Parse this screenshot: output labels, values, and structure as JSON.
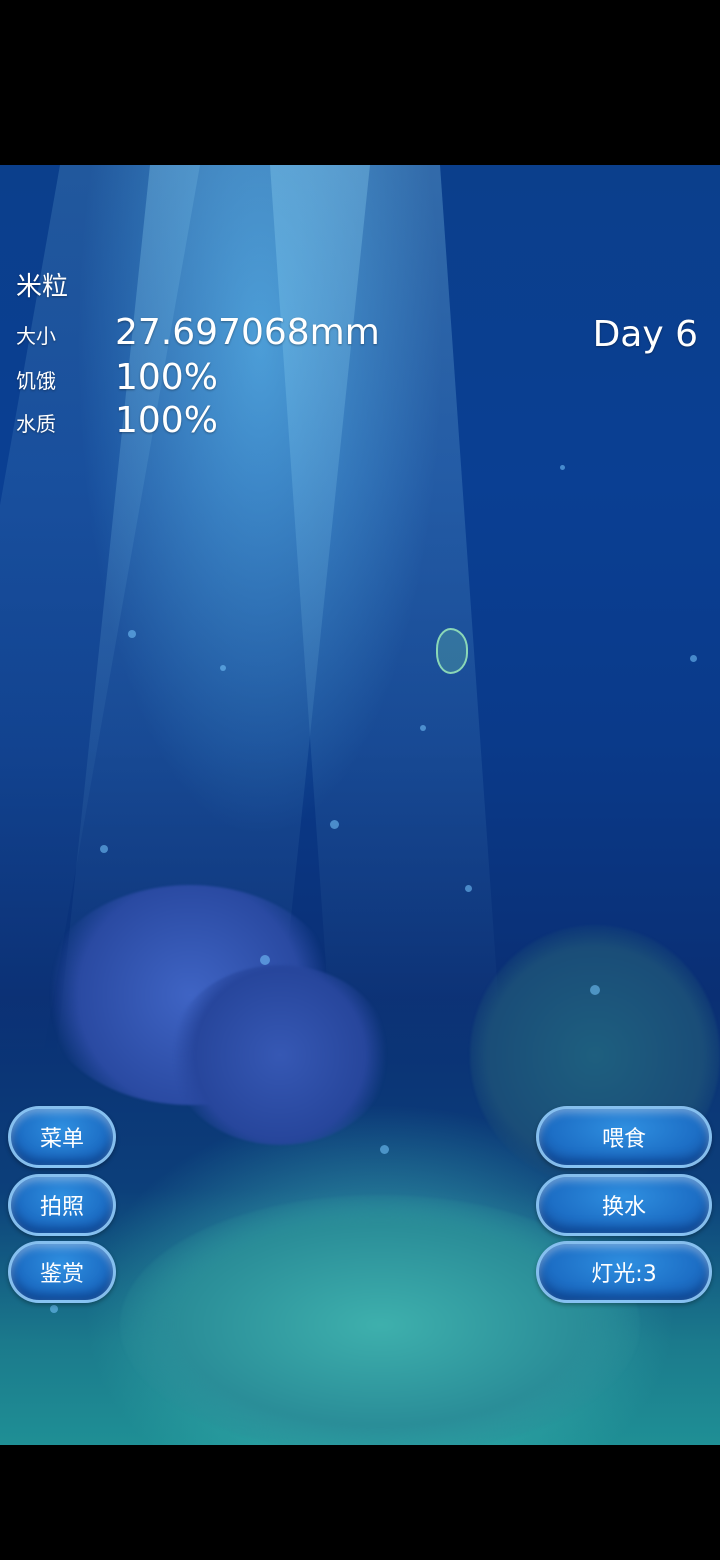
{
  "pet": {
    "name": "米粒"
  },
  "stats": [
    {
      "label": "大小",
      "value": "27.697068mm"
    },
    {
      "label": "饥饿",
      "value": "100%"
    },
    {
      "label": "水质",
      "value": "100%"
    }
  ],
  "day": "Day 6",
  "buttons_left": [
    {
      "label": "菜单"
    },
    {
      "label": "拍照"
    },
    {
      "label": "鉴赏"
    }
  ],
  "buttons_right": [
    {
      "label": "喂食"
    },
    {
      "label": "换水"
    },
    {
      "label": "灯光:3"
    }
  ]
}
